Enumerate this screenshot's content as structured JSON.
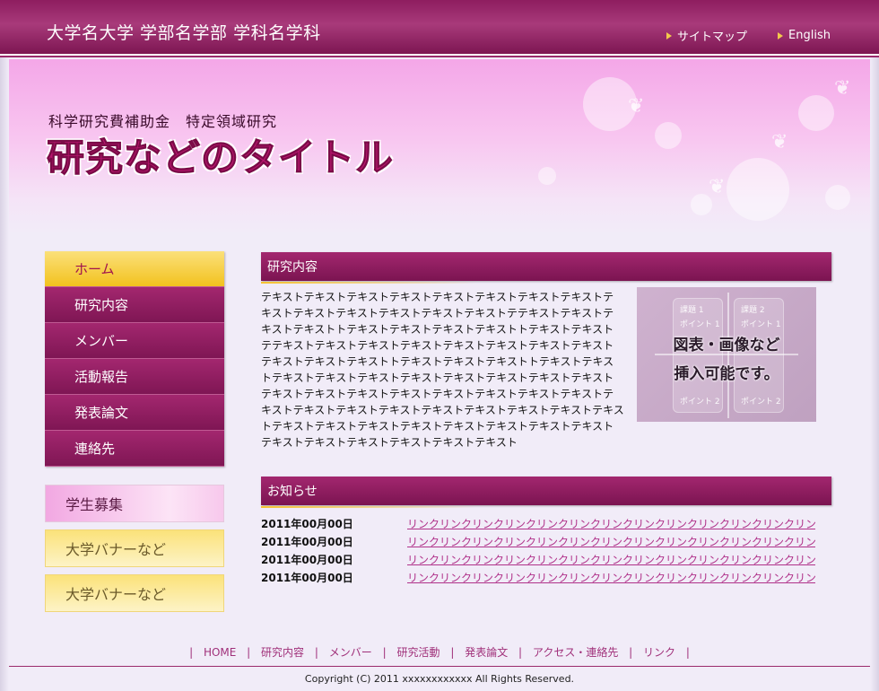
{
  "header": {
    "university": "大学名大学 学部名学部 学科名学科",
    "links": [
      "サイトマップ",
      "English"
    ]
  },
  "banner": {
    "subtitle": "科学研究費補助金　特定領域研究",
    "title": "研究などのタイトル"
  },
  "sidebar": {
    "items": [
      {
        "label": "ホーム",
        "active": true
      },
      {
        "label": "研究内容"
      },
      {
        "label": "メンバー"
      },
      {
        "label": "活動報告"
      },
      {
        "label": "発表論文"
      },
      {
        "label": "連絡先"
      }
    ],
    "banners": [
      "学生募集",
      "大学バナーなど",
      "大学バナーなど"
    ]
  },
  "research": {
    "heading": "研究内容",
    "text": "テキストテキストテキストテキストテキストテキストテキストテキストテキストテキストテキストテキストテキストテキストテテキストテキストテキストテキストトテキストテキストテキストテキストトテキストテキストテテキストテキストテキストテキストテキストテキストテキストテキストテキストテキストテキストトテキストテキストテキストトテキストテキストテキストテキストテキストテキストテキストテキストテキストテキストテキストテキストテキストテキストテキストテキストテキストテキストテキストテキストテキストテキストテキストテキストテキストテキストテキストテキストテキストテキストテキストテキストテキストテキストテキストテキストテキストテキストテキストテキストテキスト",
    "figure": {
      "caption_line1": "図表・画像など",
      "caption_line2": "挿入可能です。",
      "box1": "課題 1",
      "box2": "課題 2",
      "point1": "ポイント 1",
      "point2": "ポイント 2"
    }
  },
  "news": {
    "heading": "お知らせ",
    "items": [
      {
        "date": "2011年00月00日",
        "link": "リンクリンクリンクリンクリンクリンクリンクリンクリンクリンクリンクリンクリンクリンク"
      },
      {
        "date": "2011年00月00日",
        "link": "リンクリンクリンクリンクリンクリンクリンクリンクリンクリンクリンクリンクリンクリンク"
      },
      {
        "date": "2011年00月00日",
        "link": "リンクリンクリンクリンクリンクリンクリンクリンクリンクリンクリンクリンクリンクリンク"
      },
      {
        "date": "2011年00月00日",
        "link": "リンクリンクリンクリンクリンクリンクリンクリンクリンクリンクリンクリンクリンクリンク"
      }
    ]
  },
  "footer": {
    "links": [
      "HOME",
      "研究内容",
      "メンバー",
      "研究活動",
      "発表論文",
      "アクセス・連絡先",
      "リンク"
    ],
    "separator": "|",
    "copyright": "Copyright (C) 2011 xxxxxxxxxxxx All Rights Reserved."
  },
  "colors": {
    "accent": "#8e1d5f",
    "highlight": "#f2c21e",
    "link": "#b0328a"
  }
}
